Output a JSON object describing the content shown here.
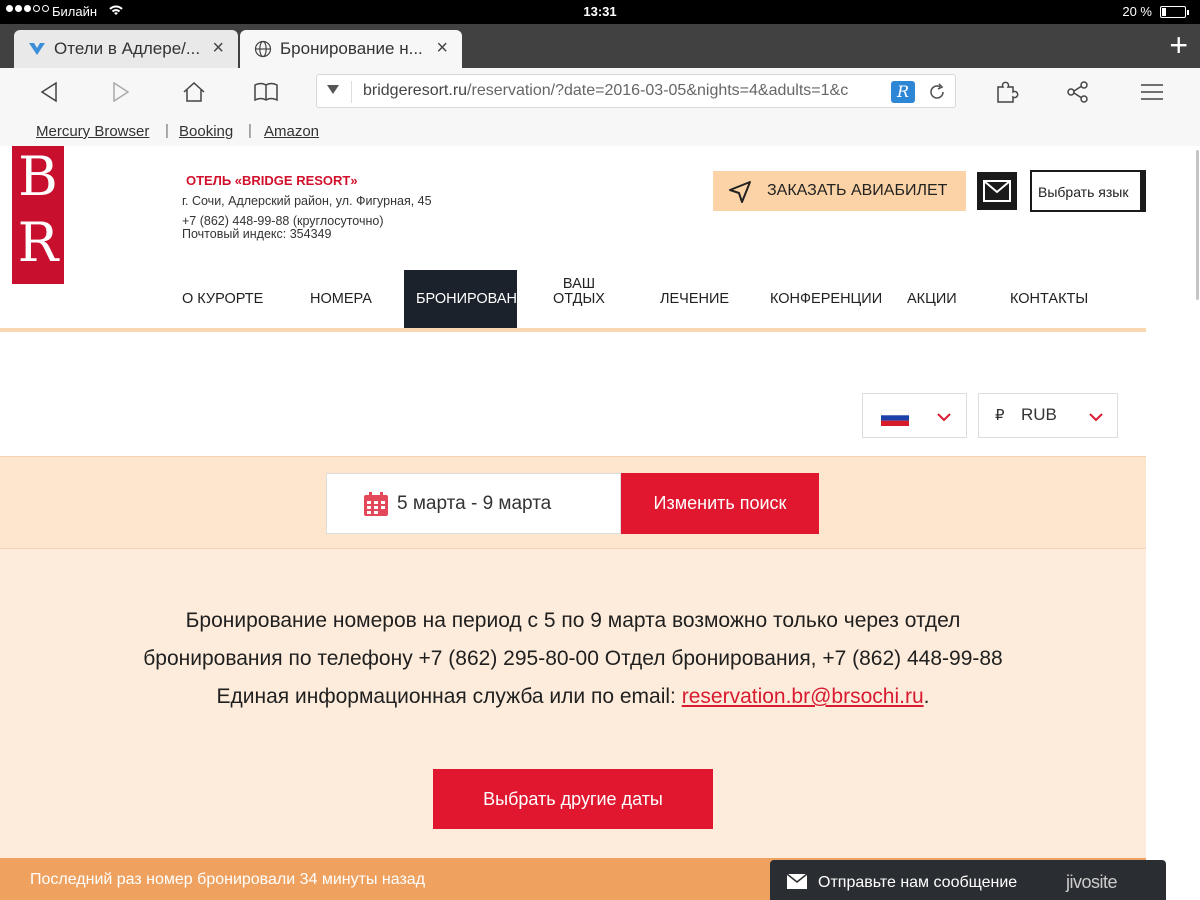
{
  "status_bar": {
    "carrier": "Билайн",
    "time": "13:31",
    "battery": "20 %",
    "battery_level": 0.2
  },
  "tabs": [
    {
      "label": "Отели в Адлере/...",
      "close": "×"
    },
    {
      "label": "Бронирование н...",
      "close": "×"
    }
  ],
  "new_tab": "+",
  "toolbar": {
    "url_host": "bridgeresort.ru",
    "url_path": "/reservation/?date=2016-03-05&nights=4&adults=1&c",
    "reader_badge": "R"
  },
  "bookmarks": [
    "Mercury Browser",
    "Booking",
    "Amazon"
  ],
  "bookmark_sep": "|",
  "header": {
    "logo_top": "B",
    "logo_bottom": "R",
    "hotel_name": "ОТЕЛЬ «BRIDGE RESORT»",
    "address": "г. Сочи, Адлерский район, ул. Фигурная, 45",
    "phone": "+7 (862) 448-99-88 (круглосуточно)",
    "postal": "Почтовый индекс: 354349",
    "flight_button": "ЗАКАЗАТЬ АВИАБИЛЕТ",
    "language_select": "Выбрать язык"
  },
  "nav": {
    "items": [
      "О КУРОРТЕ",
      "НОМЕРА",
      "БРОНИРОВАН",
      "ВАШ ОТДЫХ",
      "ЛЕЧЕНИЕ",
      "КОНФЕРЕНЦИИ",
      "АКЦИИ",
      "КОНТАКТЫ"
    ]
  },
  "selectors": {
    "currency_symbol": "₽",
    "currency_code": "RUB"
  },
  "search": {
    "dates": "5 марта - 9 марта",
    "change_button": "Изменить поиск"
  },
  "info": {
    "message": "Бронирование номеров на период с 5 по 9 марта возможно только через отдел бронирования по телефону +7 (862) 295-80-00 Отдел бронирования, +7 (862) 448-99-88 Единая информационная служба или по email: ",
    "email": "reservation.br@brsochi.ru",
    "period": ".",
    "other_dates_button": "Выбрать другие даты"
  },
  "bottom_bar": {
    "text": "Последний раз номер бронировали 34 минуты назад"
  },
  "chat": {
    "label": "Отправьте нам сообщение",
    "brand": "jivosite"
  },
  "colors": {
    "brand_red": "#e0172f",
    "peach": "#fde6cd",
    "nav_dark": "#1c222b",
    "orange_bar": "#efa260"
  }
}
